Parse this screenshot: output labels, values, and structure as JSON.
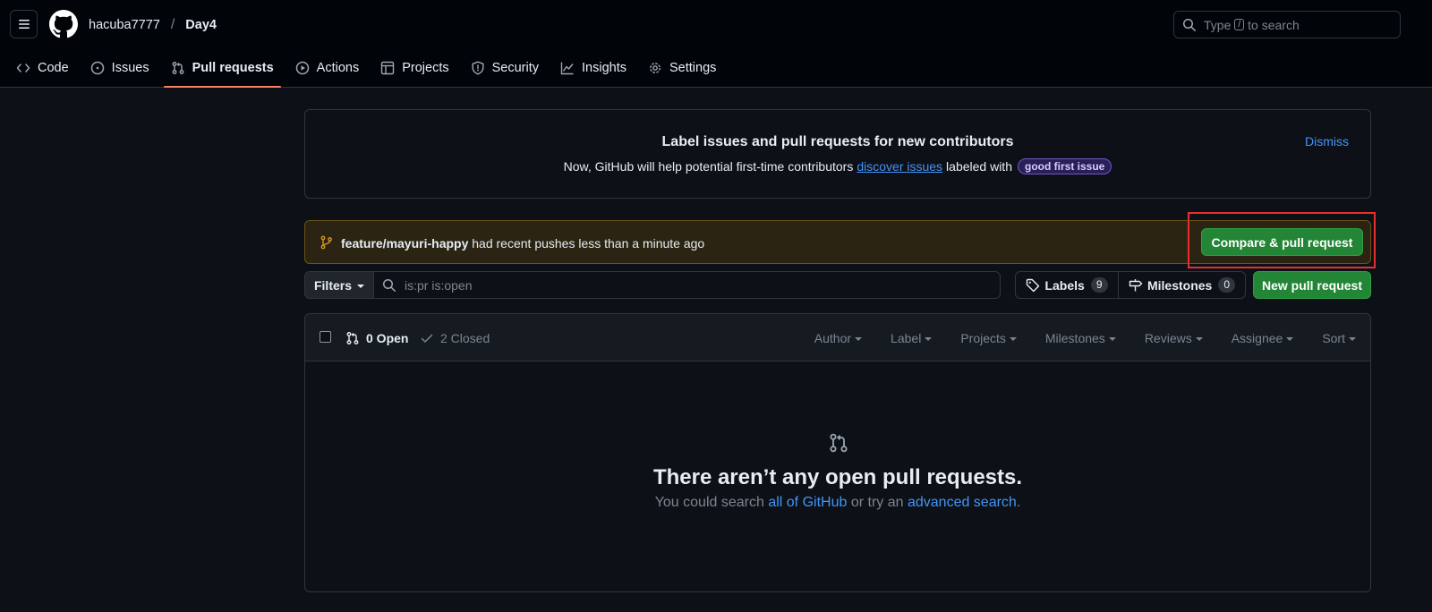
{
  "header": {
    "owner": "hacuba7777",
    "separator": "/",
    "repo": "Day4",
    "search": {
      "prefix": "Type",
      "key": "/",
      "suffix": "to search"
    }
  },
  "nav": {
    "tabs": [
      {
        "label": "Code",
        "icon": "code-icon"
      },
      {
        "label": "Issues",
        "icon": "issue-icon"
      },
      {
        "label": "Pull requests",
        "icon": "pull-request-icon",
        "active": true
      },
      {
        "label": "Actions",
        "icon": "play-icon"
      },
      {
        "label": "Projects",
        "icon": "table-icon"
      },
      {
        "label": "Security",
        "icon": "shield-icon"
      },
      {
        "label": "Insights",
        "icon": "graph-icon"
      },
      {
        "label": "Settings",
        "icon": "gear-icon"
      }
    ]
  },
  "banner": {
    "title": "Label issues and pull requests for new contributors",
    "text_before": "Now, GitHub will help potential first-time contributors",
    "link": "discover issues",
    "text_after": "labeled with",
    "badge": "good first issue",
    "dismiss": "Dismiss"
  },
  "push": {
    "branch": "feature/mayuri-happy",
    "message": "had recent pushes less than a minute ago",
    "button": "Compare & pull request"
  },
  "filters": {
    "button": "Filters",
    "query": "is:pr is:open",
    "labels": {
      "label": "Labels",
      "count": "9"
    },
    "milestones": {
      "label": "Milestones",
      "count": "0"
    },
    "new_pr": "New pull request"
  },
  "list": {
    "open": "0 Open",
    "closed": "2 Closed",
    "menus": [
      "Author",
      "Label",
      "Projects",
      "Milestones",
      "Reviews",
      "Assignee",
      "Sort"
    ]
  },
  "blankslate": {
    "title": "There aren’t any open pull requests.",
    "text1": "You could search",
    "link1": "all of GitHub",
    "text2": "or try an",
    "link2": "advanced search",
    "text3": "."
  },
  "colors": {
    "background": "#0d1117",
    "header": "#010409",
    "accent_green": "#238636",
    "link_blue": "#4493f8",
    "tab_underline": "#f78166",
    "highlight_red": "#e5302c"
  }
}
